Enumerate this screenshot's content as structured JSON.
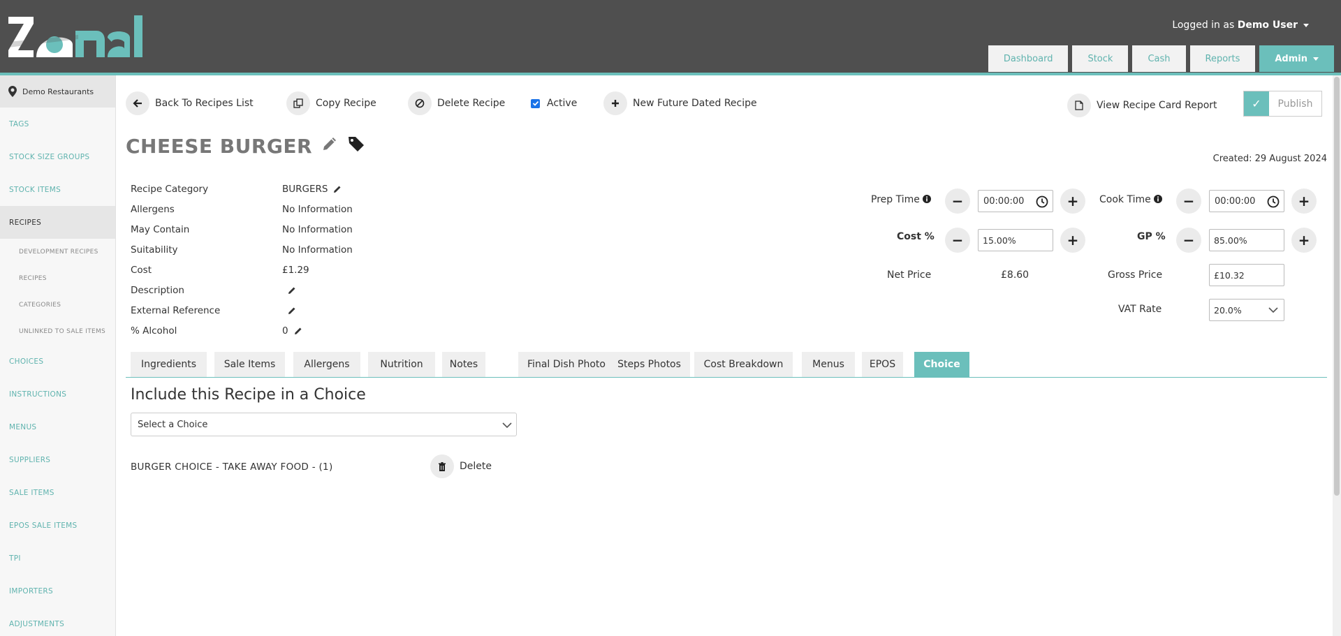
{
  "header": {
    "logo_text": "Zonal",
    "logged_in_prefix": "Logged in as ",
    "user_name": "Demo User",
    "nav": [
      {
        "label": "Dashboard"
      },
      {
        "label": "Stock"
      },
      {
        "label": "Cash"
      },
      {
        "label": "Reports"
      },
      {
        "label": "Admin",
        "active": true
      }
    ]
  },
  "sidebar": {
    "location": "Demo Restaurants",
    "items": [
      {
        "label": "TAGS"
      },
      {
        "label": "STOCK SIZE GROUPS"
      },
      {
        "label": "STOCK ITEMS"
      },
      {
        "label": "RECIPES",
        "active": true
      },
      {
        "label": "DEVELOPMENT RECIPES"
      },
      {
        "label": "RECIPES"
      },
      {
        "label": "CATEGORIES"
      },
      {
        "label": "UNLINKED TO SALE ITEMS"
      },
      {
        "label": "CHOICES"
      },
      {
        "label": "INSTRUCTIONS"
      },
      {
        "label": "MENUS"
      },
      {
        "label": "SUPPLIERS"
      },
      {
        "label": "SALE ITEMS"
      },
      {
        "label": "EPOS SALE ITEMS"
      },
      {
        "label": "TPI"
      },
      {
        "label": "IMPORTERS"
      },
      {
        "label": "ADJUSTMENTS"
      }
    ]
  },
  "toolbar": {
    "back_label": "Back To Recipes List",
    "copy_label": "Copy Recipe",
    "delete_label": "Delete Recipe",
    "active_label": "Active",
    "future_label": "New Future Dated Recipe",
    "report_label": "View Recipe Card Report",
    "publish_label": "Publish"
  },
  "recipe": {
    "title": "CHEESE BURGER",
    "created": "Created: 29 August 2024",
    "details": [
      {
        "label": "Recipe Category",
        "value": "BURGERS"
      },
      {
        "label": "Allergens",
        "value": "No Information"
      },
      {
        "label": "May Contain",
        "value": "No Information"
      },
      {
        "label": "Suitability",
        "value": "No Information"
      },
      {
        "label": "Cost",
        "value": "£1.29"
      },
      {
        "label": "Description",
        "value": ""
      },
      {
        "label": "External Reference",
        "value": ""
      },
      {
        "label": "% Alcohol",
        "value": "0"
      }
    ]
  },
  "pricing": {
    "prep_time_label": "Prep Time",
    "prep_time": "00:00:00",
    "cook_time_label": "Cook Time",
    "cook_time": "00:00:00",
    "cost_pct_label": "Cost %",
    "cost_pct": "15.00%",
    "gp_pct_label": "GP %",
    "gp_pct": "85.00%",
    "net_price_label": "Net Price",
    "net_price": "£8.60",
    "gross_price_label": "Gross Price",
    "gross_price": "£10.32",
    "vat_rate_label": "VAT Rate",
    "vat_rate": "20.0%"
  },
  "tabs": [
    {
      "label": "Ingredients"
    },
    {
      "label": "Sale Items"
    },
    {
      "label": "Allergens"
    },
    {
      "label": "Nutrition"
    },
    {
      "label": "Notes"
    },
    {
      "label": "Final Dish Photo"
    },
    {
      "label": "Steps Photos"
    },
    {
      "label": "Cost Breakdown"
    },
    {
      "label": "Menus"
    },
    {
      "label": "EPOS"
    },
    {
      "label": "Choice",
      "active": true
    }
  ],
  "choice": {
    "section_title": "Include this Recipe in a Choice",
    "select_placeholder": "Select a Choice",
    "linked_choice": "BURGER CHOICE - TAKE AWAY FOOD - (1)",
    "delete_label": "Delete"
  },
  "colors": {
    "accent": "#6bbfbb",
    "header_bg": "#4f4f4f"
  }
}
